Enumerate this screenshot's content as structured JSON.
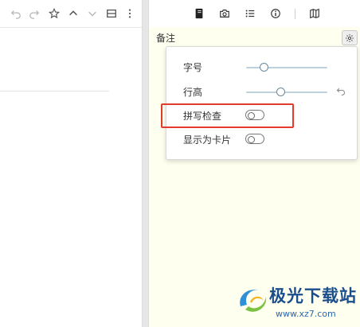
{
  "left_toolbar": {
    "icons": [
      "undo-icon",
      "redo-icon",
      "star-icon",
      "chevron-up-icon",
      "chevron-down-icon",
      "layout-icon",
      "more-icon"
    ]
  },
  "right_toolbar": {
    "icons": [
      "notebook-icon",
      "camera-icon",
      "list-icon",
      "info-icon",
      "map-icon"
    ]
  },
  "notes": {
    "title": "备注"
  },
  "settings": {
    "font_size_label": "字号",
    "font_size_value": 0.22,
    "line_height_label": "行高",
    "line_height_value": 0.42,
    "spellcheck_label": "拼写检查",
    "spellcheck_on": false,
    "show_as_card_label": "显示为卡片",
    "show_as_card_on": false
  },
  "watermark": {
    "text": "极光下载站",
    "url": "www.xz7.com"
  },
  "colors": {
    "notes_background": "#fffff0",
    "highlight": "#e23b2e"
  }
}
